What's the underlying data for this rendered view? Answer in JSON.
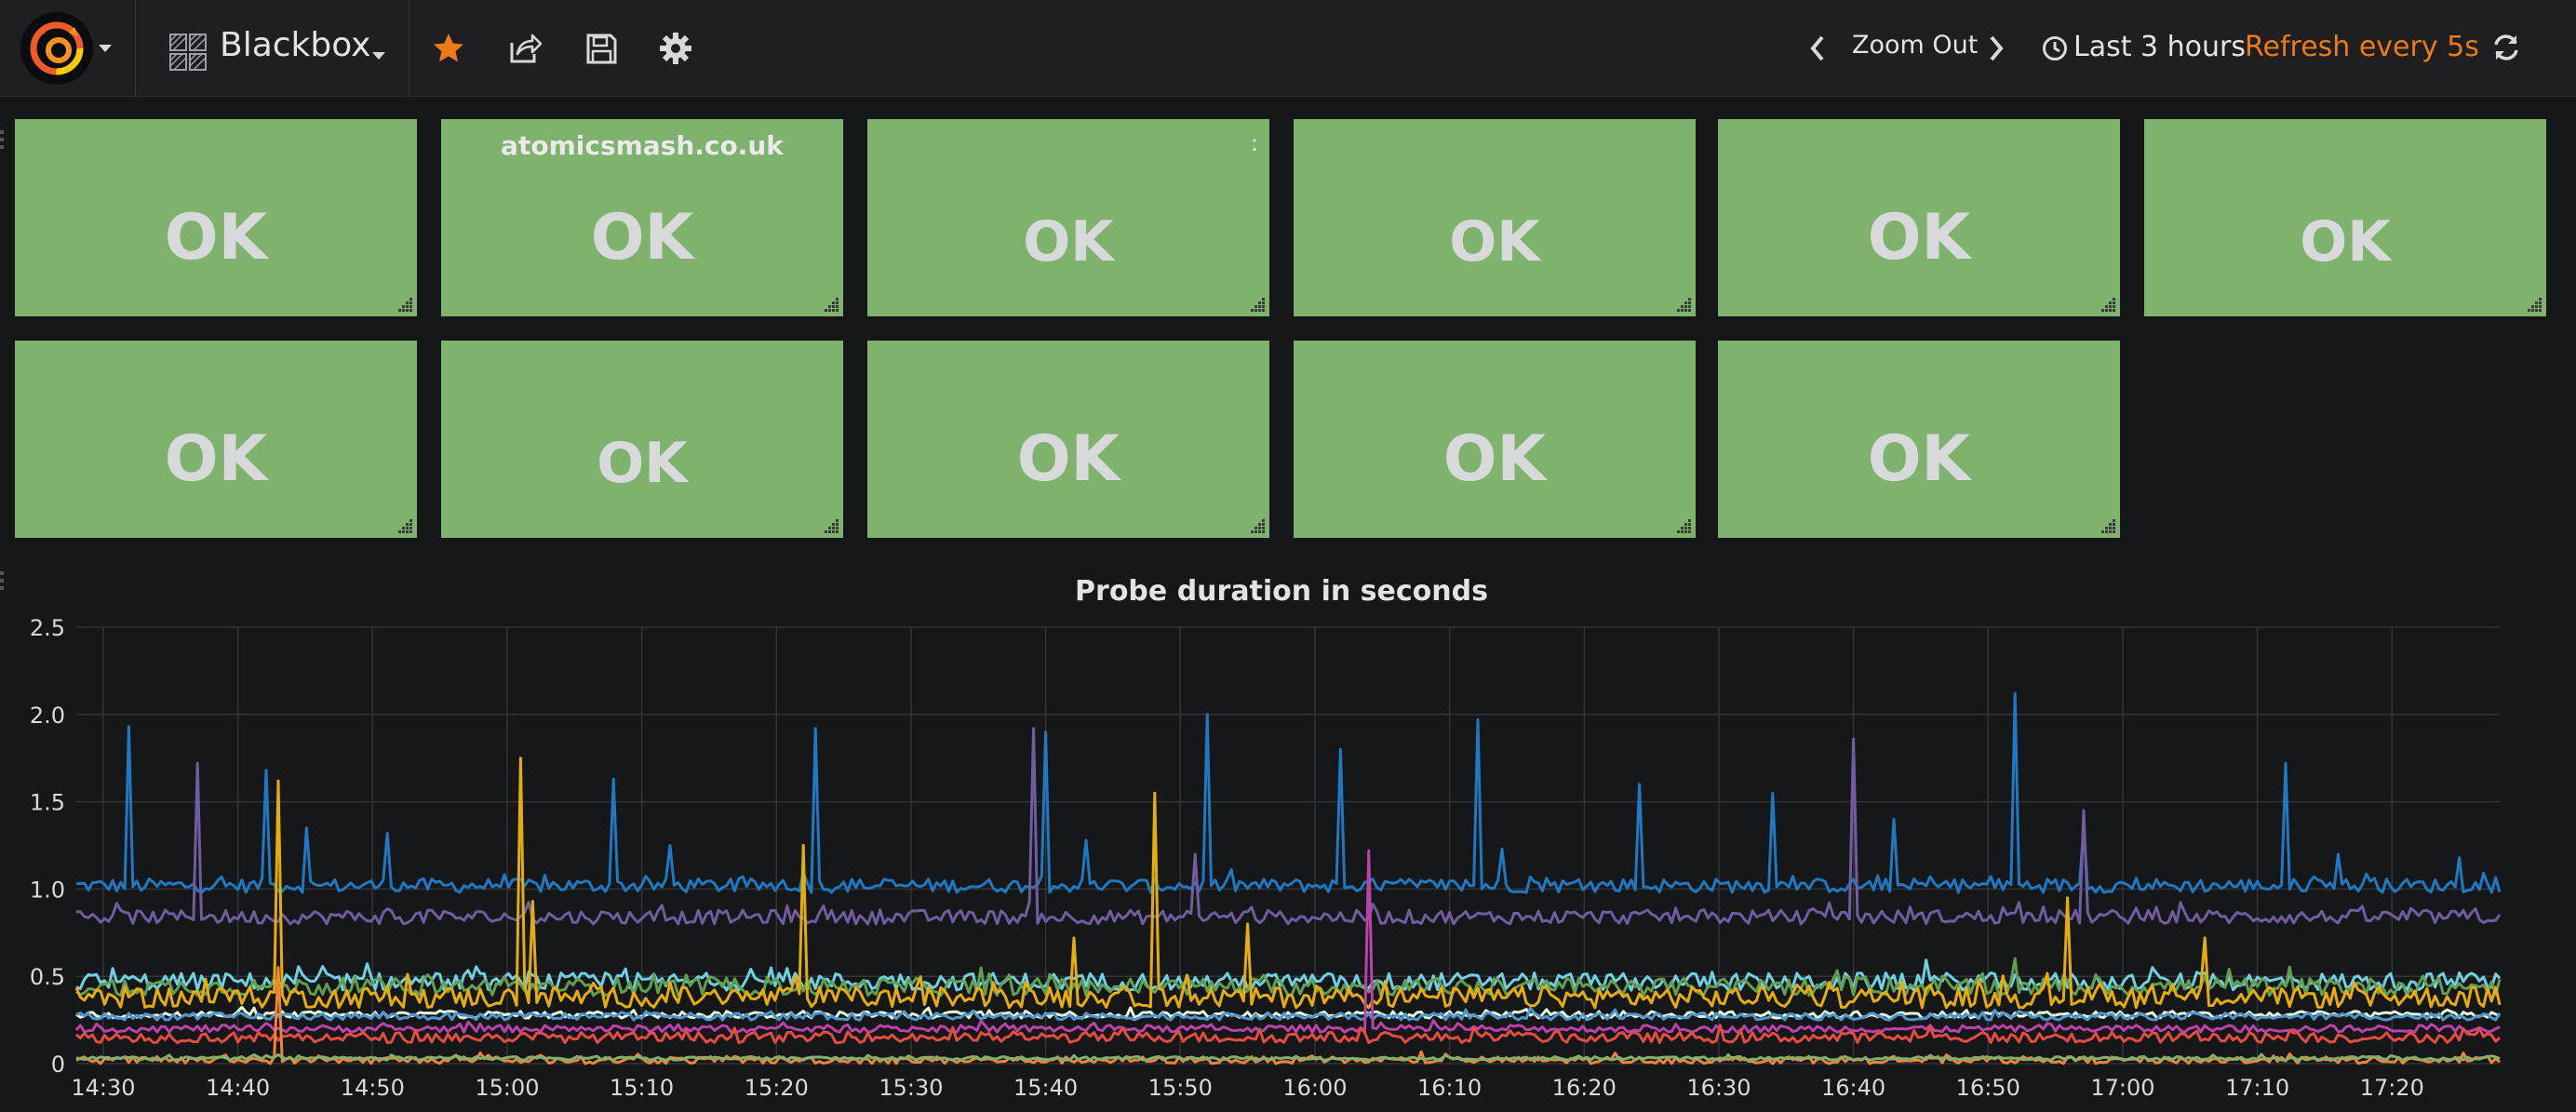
{
  "colors": {
    "background": "#161719",
    "navbar": "#1f1f22",
    "tile_ok": "#7eb26d",
    "accent_star": "#eb7b18",
    "refresh": "#eb7b18",
    "grid": "#333436",
    "text": "#d8d9da"
  },
  "navbar": {
    "logo": "grafana-logo-icon",
    "dashboard_icon": "dashboard-grid-icon",
    "dashboard_title": "Blackbox",
    "actions": [
      {
        "name": "star",
        "icon": "star-icon"
      },
      {
        "name": "share",
        "icon": "share-icon"
      },
      {
        "name": "save",
        "icon": "save-icon"
      },
      {
        "name": "settings",
        "icon": "gear-icon"
      }
    ],
    "zoom_out_label": "Zoom Out",
    "time_range_label": "Last 3 hours",
    "refresh_label": "Refresh every 5s",
    "refresh_icon": "refresh-icon"
  },
  "singlestats": [
    {
      "title": "",
      "value": "OK"
    },
    {
      "title": "atomicsmash.co.uk",
      "value": "OK"
    },
    {
      "title": ":",
      "value": "OK"
    },
    {
      "title": "",
      "value": "OK"
    },
    {
      "title": "",
      "value": "OK"
    },
    {
      "title": "",
      "value": "OK"
    },
    {
      "title": "",
      "value": "OK"
    },
    {
      "title": "",
      "value": "OK"
    },
    {
      "title": "",
      "value": "OK"
    },
    {
      "title": "",
      "value": "OK"
    },
    {
      "title": "",
      "value": "OK"
    }
  ],
  "chart_data": {
    "type": "line",
    "title": "Probe duration in seconds",
    "xlabel": "",
    "ylabel": "",
    "ylim": [
      0,
      2.5
    ],
    "yticks": [
      "0",
      "0.5",
      "1.0",
      "1.5",
      "2.0",
      "2.5"
    ],
    "xticks": [
      "14:30",
      "14:40",
      "14:50",
      "15:00",
      "15:10",
      "15:20",
      "15:30",
      "15:40",
      "15:50",
      "16:00",
      "16:10",
      "16:20",
      "16:30",
      "16:40",
      "16:50",
      "17:00",
      "17:10",
      "17:20"
    ],
    "xlim": [
      "14:28",
      "17:28"
    ],
    "grid": true,
    "legend": "none",
    "series": [
      {
        "color": "#1f78c1",
        "baseline": 1.02,
        "noise": 0.04,
        "spikes": [
          [
            "14:32",
            1.93
          ],
          [
            "14:42",
            1.68
          ],
          [
            "14:45",
            1.35
          ],
          [
            "14:51",
            1.32
          ],
          [
            "15:08",
            1.63
          ],
          [
            "15:12",
            1.25
          ],
          [
            "15:23",
            1.92
          ],
          [
            "15:40",
            1.9
          ],
          [
            "15:43",
            1.28
          ],
          [
            "15:52",
            2.0
          ],
          [
            "16:02",
            1.8
          ],
          [
            "16:12",
            1.97
          ],
          [
            "16:14",
            1.23
          ],
          [
            "16:24",
            1.6
          ],
          [
            "16:34",
            1.55
          ],
          [
            "16:43",
            1.4
          ],
          [
            "16:52",
            2.12
          ],
          [
            "16:57",
            1.35
          ],
          [
            "17:12",
            1.72
          ],
          [
            "17:16",
            1.2
          ],
          [
            "17:25",
            1.18
          ]
        ]
      },
      {
        "color": "#705da0",
        "baseline": 0.84,
        "noise": 0.04,
        "spikes": [
          [
            "14:37",
            1.72
          ],
          [
            "15:39",
            1.92
          ],
          [
            "15:51",
            1.2
          ],
          [
            "16:40",
            1.86
          ],
          [
            "16:57",
            1.45
          ]
        ]
      },
      {
        "color": "#6ed0e0",
        "baseline": 0.47,
        "noise": 0.05,
        "spikes": []
      },
      {
        "color": "#629e51",
        "baseline": 0.44,
        "noise": 0.05,
        "spikes": [
          [
            "16:52",
            0.6
          ]
        ]
      },
      {
        "color": "#e5ac0e",
        "baseline": 0.38,
        "noise": 0.06,
        "spikes": [
          [
            "14:43",
            1.62
          ],
          [
            "15:01",
            1.75
          ],
          [
            "15:02",
            0.93
          ],
          [
            "15:22",
            1.25
          ],
          [
            "15:42",
            0.72
          ],
          [
            "15:48",
            1.55
          ],
          [
            "15:55",
            0.8
          ],
          [
            "16:56",
            0.95
          ],
          [
            "17:06",
            0.72
          ]
        ]
      },
      {
        "color": "#e0f9d7",
        "baseline": 0.28,
        "noise": 0.02,
        "spikes": []
      },
      {
        "color": "#5195ce",
        "baseline": 0.27,
        "noise": 0.02,
        "spikes": []
      },
      {
        "color": "#ba43a9",
        "baseline": 0.2,
        "noise": 0.02,
        "spikes": [
          [
            "16:04",
            1.22
          ]
        ]
      },
      {
        "color": "#e24d42",
        "baseline": 0.15,
        "noise": 0.03,
        "spikes": []
      },
      {
        "color": "#ef843c",
        "baseline": 0.02,
        "noise": 0.02,
        "spikes": [
          [
            "14:43",
            0.55
          ]
        ]
      },
      {
        "color": "#7eb26d",
        "baseline": 0.03,
        "noise": 0.01,
        "spikes": []
      }
    ]
  }
}
